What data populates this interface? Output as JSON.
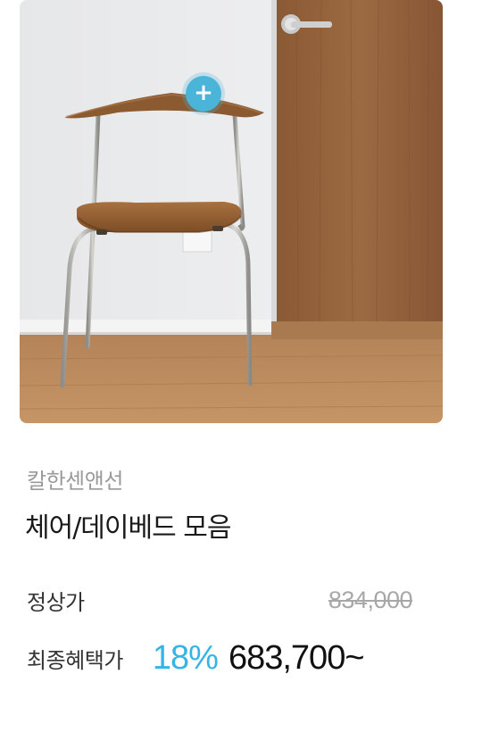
{
  "product": {
    "brand": "칼한센앤선",
    "title": "체어/데이베드 모음",
    "normal_price_label": "정상가",
    "normal_price": "834,000",
    "final_price_label": "최종혜택가",
    "discount_rate": "18%",
    "final_price": "683,700~"
  },
  "image": {
    "plus_button_glyph": "+",
    "plus_button_icon": "plus-icon"
  },
  "colors": {
    "accent": "#35b4e6",
    "plus_button": "#4bb5d9",
    "brand_text": "#9a9a9a",
    "strikethrough_price": "#a8a8a8"
  }
}
